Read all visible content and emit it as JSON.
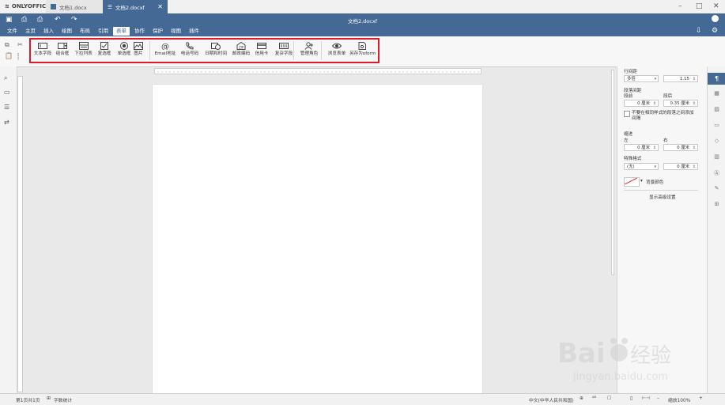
{
  "app": {
    "name": "ONLYOFFICE"
  },
  "tabs": [
    {
      "label": "文档1.docx"
    },
    {
      "label": "文档2.docxf"
    }
  ],
  "document_title": "文档2.docxf",
  "menu": [
    "文件",
    "主页",
    "插入",
    "绘图",
    "布局",
    "引用",
    "表单",
    "协作",
    "保护",
    "视图",
    "插件"
  ],
  "active_menu": "表单",
  "toolbar": {
    "buttons": [
      {
        "label": "文本字段",
        "icon": "text-field-icon"
      },
      {
        "label": "组合框",
        "icon": "combo-box-icon"
      },
      {
        "label": "下拉列表",
        "icon": "dropdown-list-icon"
      },
      {
        "label": "复选框",
        "icon": "checkbox-icon"
      },
      {
        "label": "单选框",
        "icon": "radio-button-icon"
      },
      {
        "label": "图片",
        "icon": "image-icon"
      },
      {
        "label": "Email地址",
        "icon": "email-icon"
      },
      {
        "label": "电话号码",
        "icon": "phone-icon"
      },
      {
        "label": "日期和时间",
        "icon": "date-time-icon"
      },
      {
        "label": "邮政编码",
        "icon": "zip-code-icon"
      },
      {
        "label": "信用卡",
        "icon": "credit-card-icon"
      },
      {
        "label": "复杂字段",
        "icon": "complex-field-icon"
      },
      {
        "label": "管理角色",
        "icon": "manage-roles-icon"
      },
      {
        "label": "浏览表单",
        "icon": "view-form-icon"
      },
      {
        "label": "另存为oform",
        "icon": "save-oform-icon"
      }
    ]
  },
  "right_panel": {
    "line_spacing_label": "行间距",
    "line_spacing_mode": "多倍",
    "line_spacing_value": "1.15",
    "paragraph_spacing_label": "段落间距",
    "before_label": "段前",
    "after_label": "段后",
    "before_value": "0 厘米",
    "after_value": "0.35 厘米",
    "no_space_same_style": "不要在相同样式的段落之间添加间隔",
    "indent_label": "缩进",
    "left_label": "左",
    "right_label": "右",
    "left_value": "0 厘米",
    "right_value": "0 厘米",
    "special_label": "特殊格式",
    "special_value": "(无)",
    "special_amount": "0 厘米",
    "bg_color_label": "背景颜色",
    "advanced_link": "显示高级设置"
  },
  "status": {
    "page": "第1页共1页",
    "word_count": "字数统计",
    "language": "中文(中华人民共和国)",
    "zoom": "缩放100%"
  },
  "colors": {
    "header": "#446995",
    "highlight": "#e11a2a"
  }
}
